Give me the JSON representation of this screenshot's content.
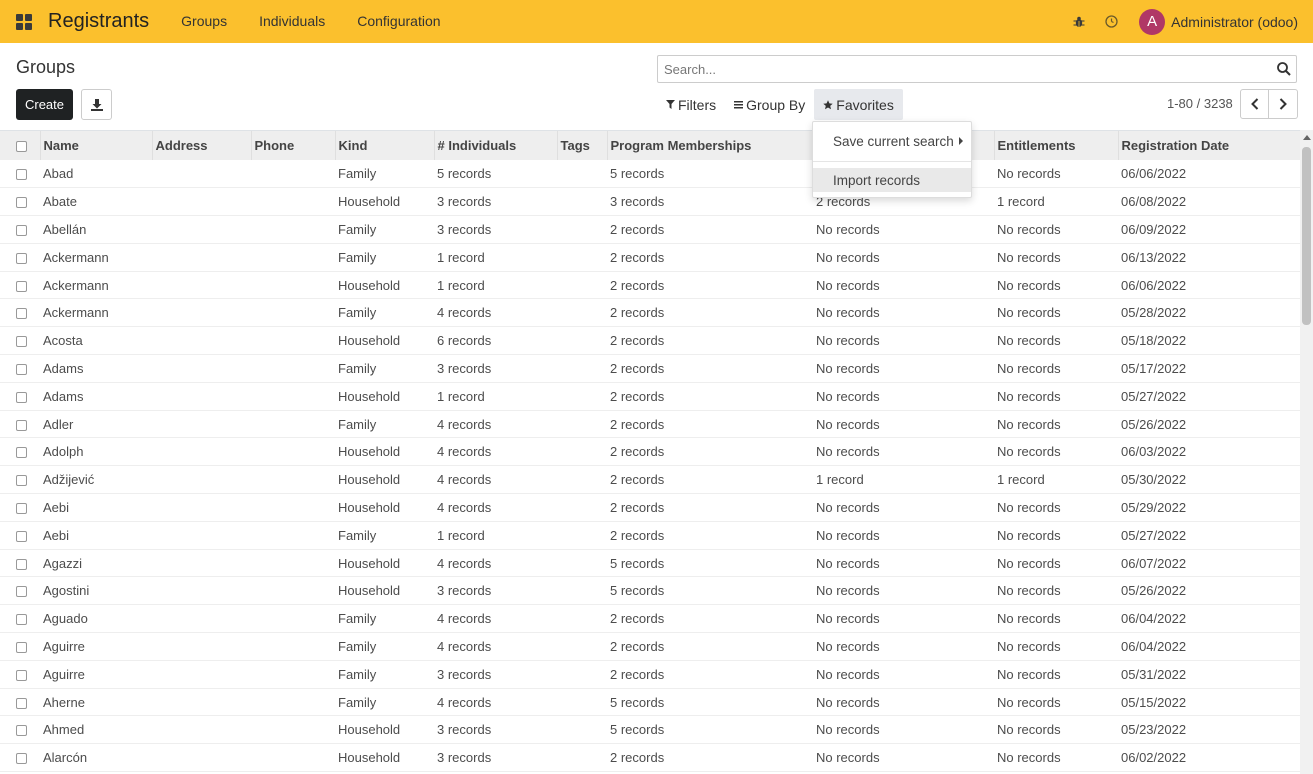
{
  "app": {
    "brand": "Registrants",
    "menu": [
      "Groups",
      "Individuals",
      "Configuration"
    ],
    "user_initial": "A",
    "user_name": "Administrator (odoo)"
  },
  "control": {
    "title": "Groups",
    "create_label": "Create",
    "search_placeholder": "Search...",
    "filters_label": "Filters",
    "groupby_label": "Group By",
    "favorites_label": "Favorites",
    "pager": "1-80 / 3238"
  },
  "dropdown": {
    "save_search": "Save current search",
    "import_records": "Import records"
  },
  "table": {
    "columns": [
      "Name",
      "Address",
      "Phone",
      "Kind",
      "# Individuals",
      "Tags",
      "Program Memberships",
      "",
      "Entitlements",
      "Registration Date"
    ],
    "rows": [
      [
        "Abad",
        "",
        "",
        "Family",
        "5 records",
        "",
        "5 records",
        "",
        "No records",
        "06/06/2022"
      ],
      [
        "Abate",
        "",
        "",
        "Household",
        "3 records",
        "",
        "3 records",
        "2 records",
        "1 record",
        "06/08/2022"
      ],
      [
        "Abellán",
        "",
        "",
        "Family",
        "3 records",
        "",
        "2 records",
        "No records",
        "No records",
        "06/09/2022"
      ],
      [
        "Ackermann",
        "",
        "",
        "Family",
        "1 record",
        "",
        "2 records",
        "No records",
        "No records",
        "06/13/2022"
      ],
      [
        "Ackermann",
        "",
        "",
        "Household",
        "1 record",
        "",
        "2 records",
        "No records",
        "No records",
        "06/06/2022"
      ],
      [
        "Ackermann",
        "",
        "",
        "Family",
        "4 records",
        "",
        "2 records",
        "No records",
        "No records",
        "05/28/2022"
      ],
      [
        "Acosta",
        "",
        "",
        "Household",
        "6 records",
        "",
        "2 records",
        "No records",
        "No records",
        "05/18/2022"
      ],
      [
        "Adams",
        "",
        "",
        "Family",
        "3 records",
        "",
        "2 records",
        "No records",
        "No records",
        "05/17/2022"
      ],
      [
        "Adams",
        "",
        "",
        "Household",
        "1 record",
        "",
        "2 records",
        "No records",
        "No records",
        "05/27/2022"
      ],
      [
        "Adler",
        "",
        "",
        "Family",
        "4 records",
        "",
        "2 records",
        "No records",
        "No records",
        "05/26/2022"
      ],
      [
        "Adolph",
        "",
        "",
        "Household",
        "4 records",
        "",
        "2 records",
        "No records",
        "No records",
        "06/03/2022"
      ],
      [
        "Adžijević",
        "",
        "",
        "Household",
        "4 records",
        "",
        "2 records",
        "1 record",
        "1 record",
        "05/30/2022"
      ],
      [
        "Aebi",
        "",
        "",
        "Household",
        "4 records",
        "",
        "2 records",
        "No records",
        "No records",
        "05/29/2022"
      ],
      [
        "Aebi",
        "",
        "",
        "Family",
        "1 record",
        "",
        "2 records",
        "No records",
        "No records",
        "05/27/2022"
      ],
      [
        "Agazzi",
        "",
        "",
        "Household",
        "4 records",
        "",
        "5 records",
        "No records",
        "No records",
        "06/07/2022"
      ],
      [
        "Agostini",
        "",
        "",
        "Household",
        "3 records",
        "",
        "5 records",
        "No records",
        "No records",
        "05/26/2022"
      ],
      [
        "Aguado",
        "",
        "",
        "Family",
        "4 records",
        "",
        "2 records",
        "No records",
        "No records",
        "06/04/2022"
      ],
      [
        "Aguirre",
        "",
        "",
        "Family",
        "4 records",
        "",
        "2 records",
        "No records",
        "No records",
        "06/04/2022"
      ],
      [
        "Aguirre",
        "",
        "",
        "Family",
        "3 records",
        "",
        "2 records",
        "No records",
        "No records",
        "05/31/2022"
      ],
      [
        "Aherne",
        "",
        "",
        "Family",
        "4 records",
        "",
        "5 records",
        "No records",
        "No records",
        "05/15/2022"
      ],
      [
        "Ahmed",
        "",
        "",
        "Household",
        "3 records",
        "",
        "5 records",
        "No records",
        "No records",
        "05/23/2022"
      ],
      [
        "Alarcón",
        "",
        "",
        "Household",
        "3 records",
        "",
        "2 records",
        "No records",
        "No records",
        "06/02/2022"
      ],
      [
        "",
        "",
        "",
        "",
        "",
        "",
        "",
        "",
        "",
        ""
      ]
    ]
  },
  "colors": {
    "navbar": "#fbc02d",
    "create_button": "#1f2223",
    "avatar": "#b03766"
  }
}
